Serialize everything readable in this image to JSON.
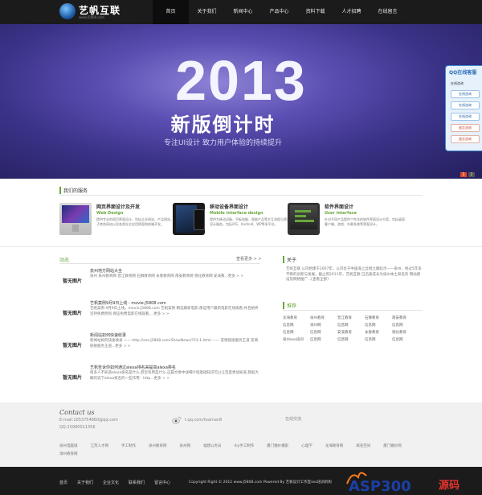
{
  "header": {
    "logo_text": "艺帆互联",
    "logo_url": "www.J5808.com",
    "nav": [
      "首页",
      "关于我们",
      "新闻中心",
      "产品中心",
      "资料下载",
      "人才招聘",
      "在线留言"
    ]
  },
  "banner": {
    "year": "2013",
    "headline": "新版倒计时",
    "subline": "专注UI设计  致力用户体验的持续提升",
    "slides": [
      "1",
      "2"
    ]
  },
  "qq_widget": {
    "title": "QQ在线客服",
    "row1": "在线咨询",
    "buttons": [
      "在线咨询",
      "在线咨询",
      "在线咨询",
      "留言咨询",
      "留言咨询"
    ]
  },
  "services": {
    "title": "我们的服务",
    "items": [
      {
        "name": "网页界面设计及开发",
        "en": "Web Design",
        "desc": "提供专业的网页界面设计，包括企业网站、产品网站、电子商务网站以及各类社交应用界面和前端开发。"
      },
      {
        "name": "移动设备界面设计",
        "en": "Mobile interface design",
        "desc": "提供为移动设备、平板电脑、智能产品等交互流程与界面设计服务，包括iOS、Android、WP等多平台。"
      },
      {
        "name": "软件界面设计",
        "en": "User interface",
        "desc": "针对不同产品提供个性化的软件界面设计方案，包括桌面客户端、游戏、车载系统等界面设计。"
      }
    ]
  },
  "news": {
    "title": "动态",
    "more": "查看更多 > >",
    "thumb_label": "暂无图片",
    "items": [
      {
        "head": "泉州地方网站大全",
        "body": "泉州    泉州教育网    晋江教育网    石狮教育网    永春教育网    南安教育网    德化教育网    安溪教...更多 > >"
      },
      {
        "head": "艺帆案例9月9日上线 - movie.J5808.com",
        "body": "艺帆案例 9月9日上线，movie.J5808.com 艺帆案例 精选最新电影,保证用户最新电影在线观看,并且始终坚持免费原则,保证免费电影在线观看,...更多 > >"
      },
      {
        "head": "新闻站如何快速收录",
        "body": "新闻站如何快速收录 —— http://seo.J5808.com/ShowNews/?53-1.html —— 友情链接服务王道    友情链接服务王道...更多 > >"
      },
      {
        "head": "艺帆告诉你如何通过alexa排名来提高alexa排名",
        "body": "很多人不知道alexa排名是什么,甚至有用是什么,这篇文章中详细介绍基础知识可以让百度更加知道,我就大概的说下alexa排名的一些作用：http...更多 > >"
      }
    ]
  },
  "about": {
    "title": "关于",
    "text": "艺帆互联 公司始建于2007年，公司位于中国海上丝绸之路起点——泉州，经过5年多不断的创新与发展，截止到2011年，艺帆互联 已迅速成长为泉州本土知名的 网站建设及网络推广...[查看全部]"
  },
  "recommend": {
    "title": "推荐",
    "items": [
      "龙海教育",
      "泉州教育",
      "晋江教育",
      "石狮教育",
      "南安教育",
      "信息网",
      "泉州网",
      "信息网",
      "信息网",
      "信息网",
      "信息网",
      "信息网",
      "安溪教育",
      "永春教育",
      "德化教育",
      "泉州seo培训",
      "信息网",
      "信息网",
      "信息网",
      "信息网"
    ]
  },
  "contact": {
    "title": "Contact us",
    "email": "E-mail:1053754860@qq.com",
    "qq": "QQ:15980011356",
    "weibo": "t.qq.com/teaman8",
    "online": "在线交流",
    "links": [
      "泉州电脑城",
      "江苏人才网",
      "手工制作",
      "泉州教育网",
      "泉州网",
      "福建公务员",
      "diy手工制作",
      "厦门婚纱摄影",
      "心理学",
      "龙海教育网",
      "域名空间",
      "厦门婚纱网",
      "漳州教育网"
    ]
  },
  "footer": {
    "nav": [
      "首页",
      "关于我们",
      "企业文化",
      "联系我们",
      "留言中心"
    ],
    "copyright": "Copyright Right © 2012 www.J5808.com Powered By 艺帆设计工作室seo培训机构",
    "watermark": "ASP300.com 源码"
  },
  "colors": {
    "accent": "#6aa63c",
    "nav_bg": "#1b1b1b",
    "banner": "#3a3287"
  }
}
